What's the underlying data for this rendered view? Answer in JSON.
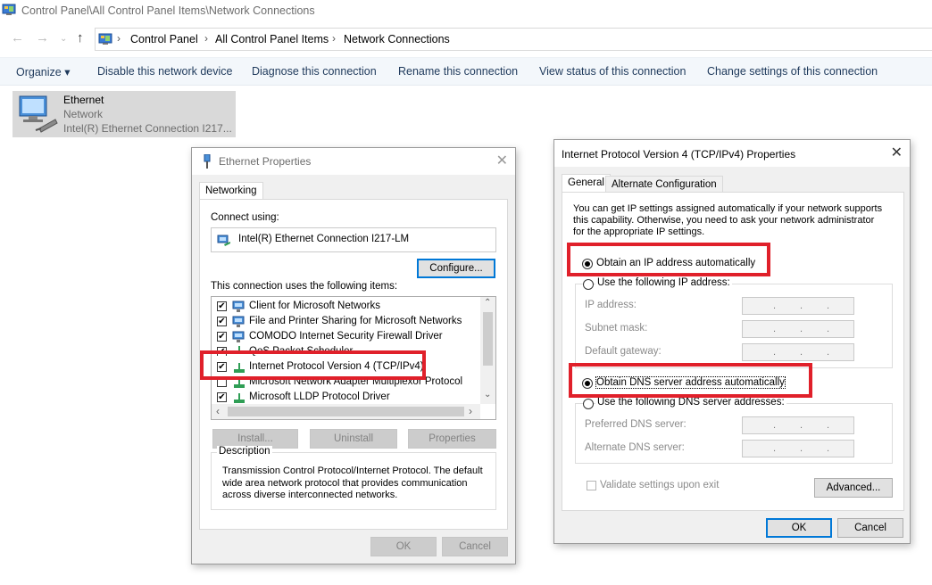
{
  "window": {
    "title": "Control Panel\\All Control Panel Items\\Network Connections"
  },
  "address_bar": {
    "crumbs": [
      "Control Panel",
      "All Control Panel Items",
      "Network Connections"
    ]
  },
  "command_bar": {
    "organize": "Organize ▾",
    "disable": "Disable this network device",
    "diagnose": "Diagnose this connection",
    "rename": "Rename this connection",
    "view_status": "View status of this connection",
    "change_settings": "Change settings of this connection"
  },
  "connection": {
    "name": "Ethernet",
    "type": "Network",
    "adapter": "Intel(R) Ethernet Connection I217..."
  },
  "ethernet_properties": {
    "title": "Ethernet Properties",
    "tab": "Networking",
    "connect_using_label": "Connect using:",
    "adapter": "Intel(R) Ethernet Connection I217-LM",
    "configure_button": "Configure...",
    "items_label": "This connection uses the following items:",
    "items": [
      {
        "label": "Client for Microsoft Networks",
        "checked": true
      },
      {
        "label": "File and Printer Sharing for Microsoft Networks",
        "checked": true
      },
      {
        "label": "COMODO Internet Security Firewall Driver",
        "checked": true
      },
      {
        "label": "QoS Packet Scheduler",
        "checked": true
      },
      {
        "label": "Internet Protocol Version 4 (TCP/IPv4)",
        "checked": true
      },
      {
        "label": "Microsoft Network Adapter Multiplexor Protocol",
        "checked": false
      },
      {
        "label": "Microsoft LLDP Protocol Driver",
        "checked": true
      }
    ],
    "install_button": "Install...",
    "uninstall_button": "Uninstall",
    "properties_button": "Properties",
    "description_title": "Description",
    "description_text": "Transmission Control Protocol/Internet Protocol. The default wide area network protocol that provides communication across diverse interconnected networks.",
    "ok_button": "OK",
    "cancel_button": "Cancel"
  },
  "ipv4_properties": {
    "title": "Internet Protocol Version 4 (TCP/IPv4) Properties",
    "tab_general": "General",
    "tab_alternate": "Alternate Configuration",
    "intro": "You can get IP settings assigned automatically if your network supports this capability. Otherwise, you need to ask your network administrator for the appropriate IP settings.",
    "obtain_ip_auto": "Obtain an IP address automatically",
    "use_following_ip": "Use the following IP address:",
    "ip_address_label": "IP address:",
    "subnet_mask_label": "Subnet mask:",
    "default_gateway_label": "Default gateway:",
    "obtain_dns_auto": "Obtain DNS server address automatically",
    "use_following_dns": "Use the following DNS server addresses:",
    "preferred_dns_label": "Preferred DNS server:",
    "alternate_dns_label": "Alternate DNS server:",
    "validate_label": "Validate settings upon exit",
    "advanced_button": "Advanced...",
    "ok_button": "OK",
    "cancel_button": "Cancel",
    "ip_placeholder": ".          .          ."
  },
  "colors": {
    "highlight_red": "#e0202a",
    "command_text": "#1e395b",
    "focus_blue": "#0078d7"
  }
}
